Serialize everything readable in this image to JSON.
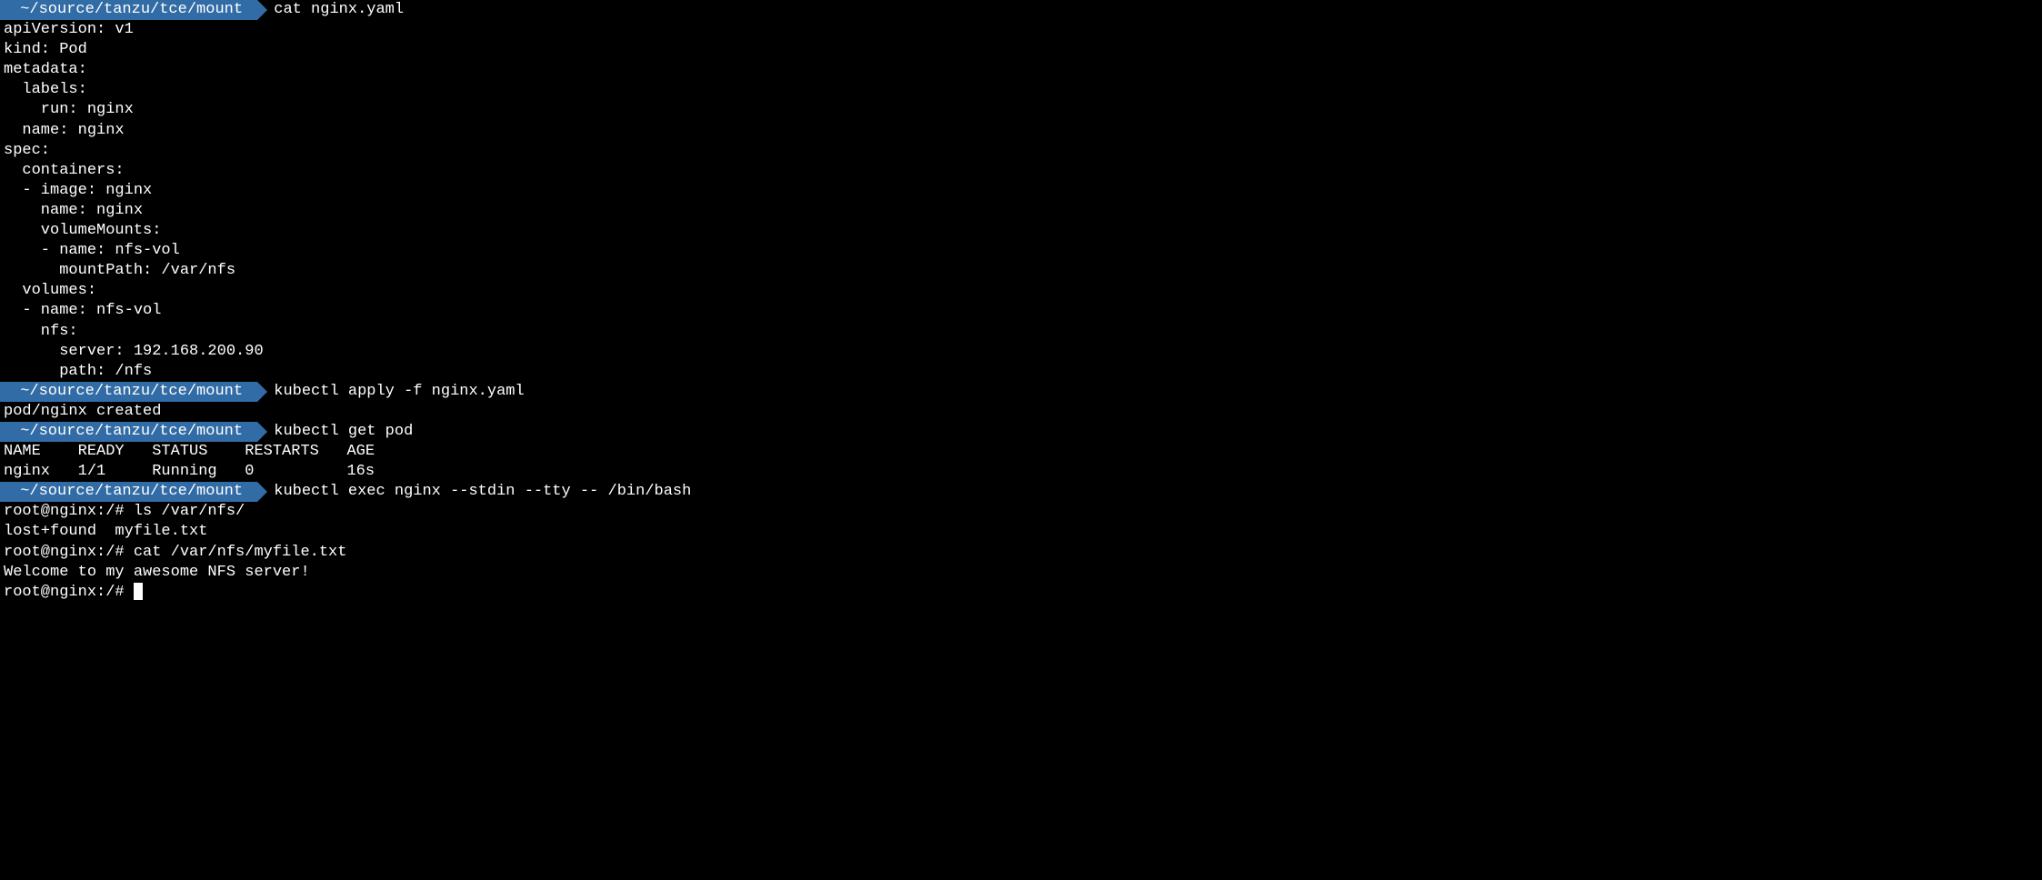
{
  "prompts": {
    "path": "~/source/tanzu/tce/mount"
  },
  "commands": {
    "cat_yaml": "cat nginx.yaml",
    "apply": "kubectl apply -f nginx.yaml",
    "get_pod": "kubectl get pod",
    "exec": "kubectl exec nginx --stdin --tty -- /bin/bash"
  },
  "yaml": {
    "l1": "apiVersion: v1",
    "l2": "kind: Pod",
    "l3": "metadata:",
    "l4": "  labels:",
    "l5": "    run: nginx",
    "l6": "  name: nginx",
    "l7": "spec:",
    "l8": "  containers:",
    "l9": "  - image: nginx",
    "l10": "    name: nginx",
    "l11": "    volumeMounts:",
    "l12": "    - name: nfs-vol",
    "l13": "      mountPath: /var/nfs",
    "l14": "  volumes:",
    "l15": "  - name: nfs-vol",
    "l16": "    nfs:",
    "l17": "      server: 192.168.200.90",
    "l18": "      path: /nfs"
  },
  "apply_output": "pod/nginx created",
  "pod_table": {
    "header": "NAME    READY   STATUS    RESTARTS   AGE",
    "row1": "nginx   1/1     Running   0          16s"
  },
  "shell": {
    "prompt1": "root@nginx:/# ls /var/nfs/",
    "ls_output": "lost+found  myfile.txt",
    "prompt2": "root@nginx:/# cat /var/nfs/myfile.txt",
    "cat_output": "Welcome to my awesome NFS server!",
    "prompt3": "root@nginx:/# "
  }
}
